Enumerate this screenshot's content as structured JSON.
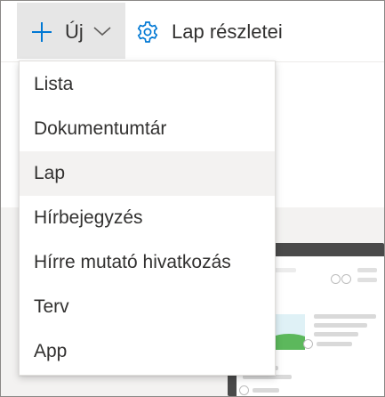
{
  "commandbar": {
    "new_label": "Új",
    "page_details_label": "Lap részletei"
  },
  "menu": {
    "items": [
      {
        "label": "Lista"
      },
      {
        "label": "Dokumentumtár"
      },
      {
        "label": "Lap"
      },
      {
        "label": "Hírbejegyzés"
      },
      {
        "label": "Hírre mutató hivatkozás"
      },
      {
        "label": "Terv"
      },
      {
        "label": "App"
      }
    ],
    "highlighted_item": "Lap"
  },
  "colors": {
    "accent": "#0078d4",
    "button_active_bg": "#e6e6e6",
    "menu_hover_bg": "#f3f2f1",
    "text": "#323130"
  },
  "icons": {
    "new": "plus-icon",
    "dropdown": "chevron-down-icon",
    "details": "gear-icon"
  }
}
